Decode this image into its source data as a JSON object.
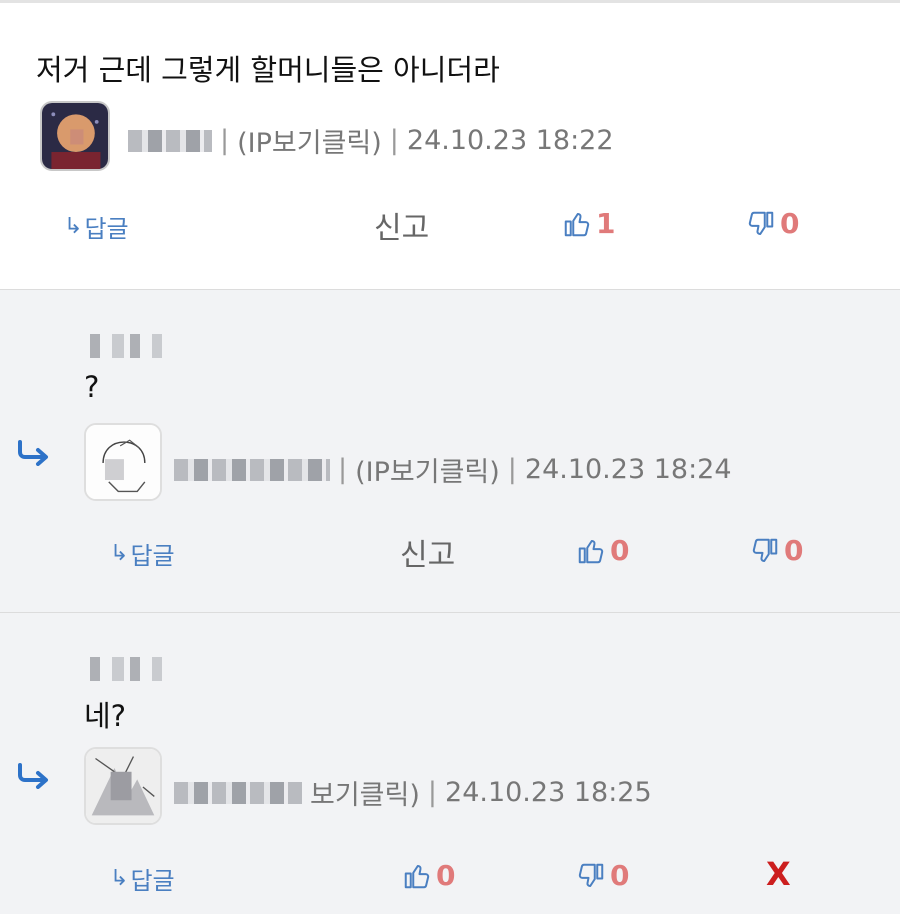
{
  "comments": [
    {
      "text": "저거 근데 그렇게 할머니들은 아니더라",
      "ip_label": "(IP보기클릭)",
      "sep": "|",
      "timestamp": "24.10.23 18:22",
      "reply_label": "답글",
      "report_label": "신고",
      "likes": "1",
      "dislikes": "0"
    },
    {
      "text": "?",
      "ip_label": "(IP보기클릭)",
      "sep": "|",
      "timestamp": "24.10.23 18:24",
      "reply_label": "답글",
      "report_label": "신고",
      "likes": "0",
      "dislikes": "0"
    },
    {
      "text": "네?",
      "ip_label": "보기클릭)",
      "sep": "|",
      "timestamp": "24.10.23 18:25",
      "reply_label": "답글",
      "likes": "0",
      "dislikes": "0",
      "delete_label": "X"
    }
  ],
  "colors": {
    "accent_blue": "#4a7fc1",
    "count_red": "#e07a7a",
    "delete_red": "#cc1e1e",
    "reply_bg": "#f2f3f5"
  },
  "icons": {
    "reply_indicator": "reply-arrow-icon",
    "like": "thumbs-up-icon",
    "dislike": "thumbs-down-icon"
  }
}
